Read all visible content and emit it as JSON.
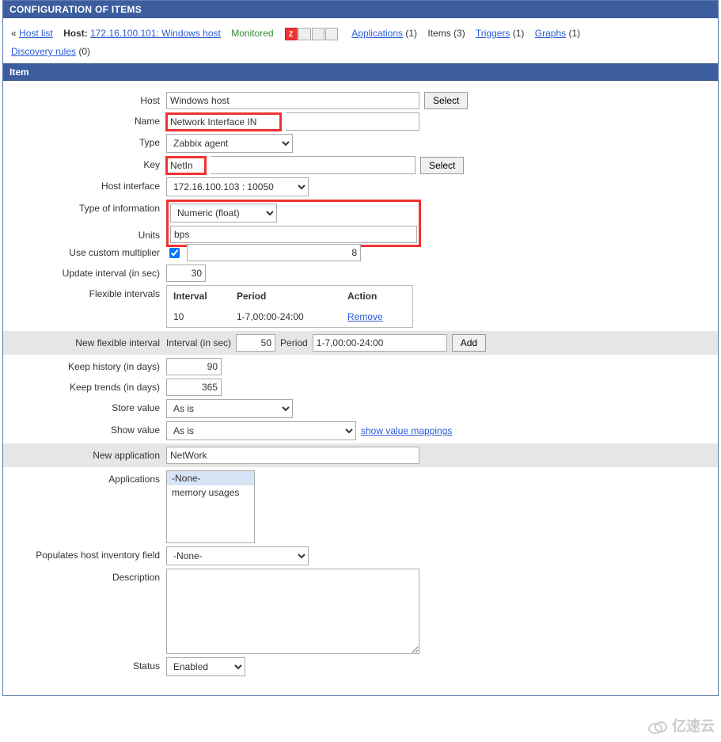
{
  "header": {
    "title": "CONFIGURATION OF ITEMS"
  },
  "breadcrumb": {
    "back_sym": "«",
    "host_list": "Host list",
    "host_label": "Host:",
    "host_value": "172.16.100.101: Windows host",
    "monitored": "Monitored",
    "applications": {
      "label": "Applications",
      "count": "(1)"
    },
    "items": {
      "label": "Items",
      "count": "(3)"
    },
    "triggers": {
      "label": "Triggers",
      "count": "(1)"
    },
    "graphs": {
      "label": "Graphs",
      "count": "(1)"
    },
    "discovery": {
      "label": "Discovery rules",
      "count": "(0)"
    }
  },
  "section": {
    "title": "Item"
  },
  "labels": {
    "host": "Host",
    "name": "Name",
    "type": "Type",
    "key": "Key",
    "host_interface": "Host interface",
    "type_info": "Type of information",
    "units": "Units",
    "use_mult": "Use custom multiplier",
    "update_int": "Update interval (in sec)",
    "flex_int": "Flexible intervals",
    "new_flex": "New flexible interval",
    "keep_hist": "Keep history (in days)",
    "keep_trend": "Keep trends (in days)",
    "store_val": "Store value",
    "show_val": "Show value",
    "new_app": "New application",
    "apps": "Applications",
    "pop_inv": "Populates host inventory field",
    "desc": "Description",
    "status": "Status"
  },
  "flex_table": {
    "h1": "Interval",
    "h2": "Period",
    "h3": "Action",
    "interval": "10",
    "period": "1-7,00:00-24:00",
    "remove": "Remove"
  },
  "new_flex": {
    "l1": "Interval (in sec)",
    "v1": "50",
    "l2": "Period",
    "v2": "1-7,00:00-24:00",
    "add": "Add"
  },
  "apps_list": {
    "none": "-None-",
    "mem": "memory usages"
  },
  "values": {
    "host": "Windows host",
    "name": "Network Interface IN",
    "type": "Zabbix agent",
    "key": "NetIn",
    "host_interface": "172.16.100.103 : 10050",
    "type_info": "Numeric (float)",
    "units": "bps",
    "mult": "8",
    "update_int": "30",
    "keep_hist": "90",
    "keep_trend": "365",
    "store_val": "As is",
    "show_val": "As is",
    "show_val_link": "show value mappings",
    "new_app": "NetWork",
    "pop_inv": "-None-",
    "status": "Enabled",
    "select": "Select"
  },
  "watermark": "亿速云"
}
